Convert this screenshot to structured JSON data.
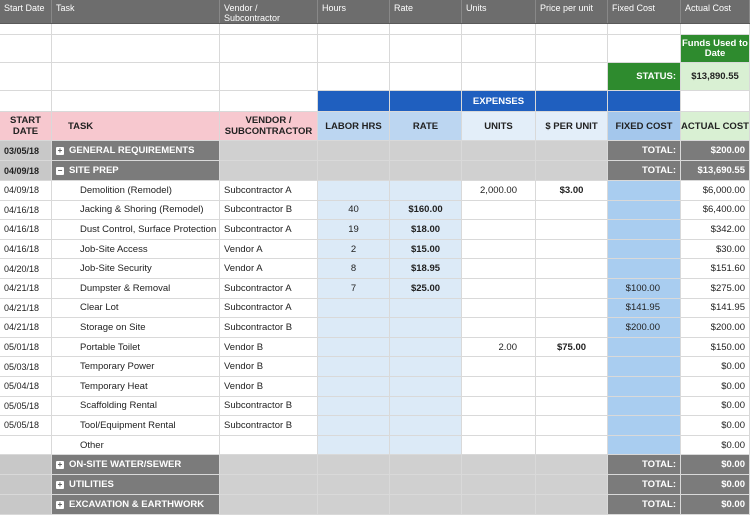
{
  "top_headers": [
    "Start Date",
    "Task",
    "Vendor / Subcontractor",
    "Hours",
    "Rate",
    "Units",
    "Price per unit",
    "Fixed Cost",
    "Actual Cost"
  ],
  "funds_label": "Funds Used to Date",
  "status": {
    "label": "STATUS:",
    "value": "$13,890.55"
  },
  "expenses_label": "EXPENSES",
  "col_headers": [
    "START DATE",
    "TASK",
    "VENDOR / SUBCONTRACTOR",
    "LABOR HRS",
    "RATE",
    "UNITS",
    "$ PER UNIT",
    "FIXED COST",
    "ACTUAL COST"
  ],
  "categories": [
    {
      "date": "03/05/18",
      "name": "GENERAL REQUIREMENTS",
      "total_label": "TOTAL:",
      "total": "$200.00"
    },
    {
      "date": "04/09/18",
      "name": "SITE PREP",
      "total_label": "TOTAL:",
      "total": "$13,690.55"
    }
  ],
  "rows": [
    {
      "date": "04/09/18",
      "task": "Demolition (Remodel)",
      "vendor": "Subcontractor A",
      "hours": "",
      "rate": "",
      "units": "2,000.00",
      "ppu": "$3.00",
      "fixed": "",
      "actual": "$6,000.00"
    },
    {
      "date": "04/16/18",
      "task": "Jacking & Shoring (Remodel)",
      "vendor": "Subcontractor B",
      "hours": "40",
      "rate": "$160.00",
      "units": "",
      "ppu": "",
      "fixed": "",
      "actual": "$6,400.00"
    },
    {
      "date": "04/16/18",
      "task": "Dust Control, Surface Protection",
      "vendor": "Subcontractor A",
      "hours": "19",
      "rate": "$18.00",
      "units": "",
      "ppu": "",
      "fixed": "",
      "actual": "$342.00"
    },
    {
      "date": "04/16/18",
      "task": "Job-Site Access",
      "vendor": "Vendor A",
      "hours": "2",
      "rate": "$15.00",
      "units": "",
      "ppu": "",
      "fixed": "",
      "actual": "$30.00"
    },
    {
      "date": "04/20/18",
      "task": "Job-Site Security",
      "vendor": "Vendor A",
      "hours": "8",
      "rate": "$18.95",
      "units": "",
      "ppu": "",
      "fixed": "",
      "actual": "$151.60"
    },
    {
      "date": "04/21/18",
      "task": "Dumpster & Removal",
      "vendor": "Subcontractor A",
      "hours": "7",
      "rate": "$25.00",
      "units": "",
      "ppu": "",
      "fixed": "$100.00",
      "actual": "$275.00"
    },
    {
      "date": "04/21/18",
      "task": "Clear Lot",
      "vendor": "Subcontractor A",
      "hours": "",
      "rate": "",
      "units": "",
      "ppu": "",
      "fixed": "$141.95",
      "actual": "$141.95"
    },
    {
      "date": "04/21/18",
      "task": "Storage on Site",
      "vendor": "Subcontractor B",
      "hours": "",
      "rate": "",
      "units": "",
      "ppu": "",
      "fixed": "$200.00",
      "actual": "$200.00"
    },
    {
      "date": "05/01/18",
      "task": "Portable Toilet",
      "vendor": "Vendor B",
      "hours": "",
      "rate": "",
      "units": "2.00",
      "ppu": "$75.00",
      "fixed": "",
      "actual": "$150.00"
    },
    {
      "date": "05/03/18",
      "task": "Temporary Power",
      "vendor": "Vendor B",
      "hours": "",
      "rate": "",
      "units": "",
      "ppu": "",
      "fixed": "",
      "actual": "$0.00"
    },
    {
      "date": "05/04/18",
      "task": "Temporary Heat",
      "vendor": "Vendor B",
      "hours": "",
      "rate": "",
      "units": "",
      "ppu": "",
      "fixed": "",
      "actual": "$0.00"
    },
    {
      "date": "05/05/18",
      "task": "Scaffolding Rental",
      "vendor": "Subcontractor B",
      "hours": "",
      "rate": "",
      "units": "",
      "ppu": "",
      "fixed": "",
      "actual": "$0.00"
    },
    {
      "date": "05/05/18",
      "task": "Tool/Equipment Rental",
      "vendor": "Subcontractor B",
      "hours": "",
      "rate": "",
      "units": "",
      "ppu": "",
      "fixed": "",
      "actual": "$0.00"
    },
    {
      "date": "",
      "task": "Other",
      "vendor": "",
      "hours": "",
      "rate": "",
      "units": "",
      "ppu": "",
      "fixed": "",
      "actual": "$0.00"
    }
  ],
  "bottom_categories": [
    {
      "name": "ON-SITE WATER/SEWER",
      "total_label": "TOTAL:",
      "total": "$0.00"
    },
    {
      "name": "UTILITIES",
      "total_label": "TOTAL:",
      "total": "$0.00"
    },
    {
      "name": "EXCAVATION & EARTHWORK",
      "total_label": "TOTAL:",
      "total": "$0.00"
    }
  ],
  "colors": {
    "header_gray": "#6d6d6d",
    "expenses_blue": "#1f5fbf",
    "category_gray": "#7b7b7b",
    "pink": "#f7c8cf",
    "light_blue": "#dceaf7",
    "status_green": "#2e8b2e"
  }
}
